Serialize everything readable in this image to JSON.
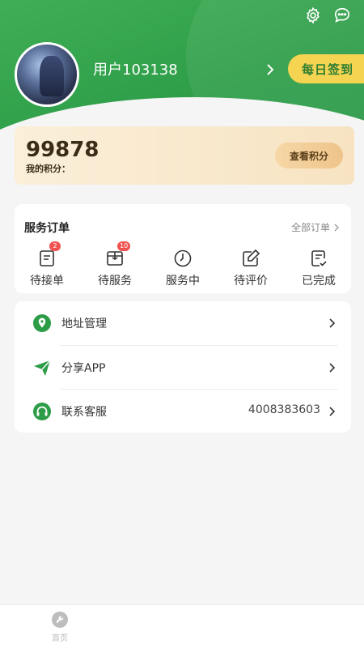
{
  "header": {
    "settings_icon": "gear-icon",
    "message_icon": "chat-bubble-icon",
    "username": "用户103138",
    "checkin_label": "每日签到"
  },
  "points": {
    "value": "99878",
    "label": "我的积分：",
    "button_label": "查看积分"
  },
  "orders": {
    "title": "服务订单",
    "all_label": "全部订单",
    "items": [
      {
        "label": "待接单",
        "icon": "clipboard-icon",
        "badge": "2"
      },
      {
        "label": "待服务",
        "icon": "package-icon",
        "badge": "10"
      },
      {
        "label": "服务中",
        "icon": "clock-icon",
        "badge": ""
      },
      {
        "label": "待评价",
        "icon": "edit-icon",
        "badge": ""
      },
      {
        "label": "已完成",
        "icon": "checklist-icon",
        "badge": ""
      }
    ]
  },
  "menu": {
    "items": [
      {
        "label": "地址管理",
        "icon": "location-icon",
        "value": ""
      },
      {
        "label": "分享APP",
        "icon": "send-icon",
        "value": ""
      },
      {
        "label": "联系客服",
        "icon": "headset-icon",
        "value": "4008383603"
      }
    ]
  },
  "tabbar": {
    "home_label": "首页"
  },
  "colors": {
    "brand_green": "#2c9c47",
    "checkin_yellow": "#f5d451",
    "badge_red": "#ef5350"
  }
}
